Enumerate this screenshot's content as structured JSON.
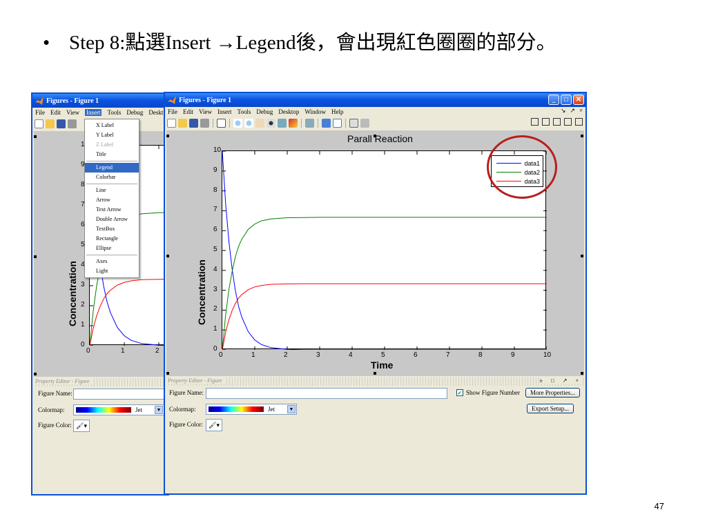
{
  "slide": {
    "bullet": "•",
    "title": "Step 8:點選Insert →Legend後，會出現紅色圈圈的部分。",
    "page_number": "47"
  },
  "window": {
    "title": "Figures - Figure 1",
    "menus": [
      "File",
      "Edit",
      "View",
      "Insert",
      "Tools",
      "Debug",
      "Desktop",
      "Window",
      "Help"
    ],
    "back_menus": [
      "File",
      "Edit",
      "View",
      "Insert",
      "Tools",
      "Debug",
      "Deskt"
    ],
    "menu_right": [
      "↘",
      "↗",
      "×"
    ]
  },
  "insert_menu": {
    "items": [
      {
        "label": "X Label",
        "state": "normal"
      },
      {
        "label": "Y Label",
        "state": "normal"
      },
      {
        "label": "Z Label",
        "state": "disabled"
      },
      {
        "label": "Title",
        "state": "normal"
      },
      {
        "label": "Legend",
        "state": "highlight"
      },
      {
        "label": "Colorbar",
        "state": "normal"
      },
      {
        "label": "Line",
        "state": "normal"
      },
      {
        "label": "Arrow",
        "state": "normal"
      },
      {
        "label": "Text Arrow",
        "state": "normal"
      },
      {
        "label": "Double Arrow",
        "state": "normal"
      },
      {
        "label": "TextBox",
        "state": "normal"
      },
      {
        "label": "Rectangle",
        "state": "normal"
      },
      {
        "label": "Ellipse",
        "state": "normal"
      },
      {
        "label": "Axes",
        "state": "normal"
      },
      {
        "label": "Light",
        "state": "normal"
      }
    ]
  },
  "property_editor": {
    "header": "Property Editor - Figure",
    "controls": [
      "±",
      "□",
      "↗",
      "×"
    ],
    "figure_name_label": "Figure Name:",
    "figure_name_value": "",
    "colormap_label": "Colormap:",
    "colormap_value": "Jet",
    "figure_color_label": "Figure Color:",
    "show_figure_number_label": "Show Figure Number",
    "show_figure_number_checked": "✔",
    "more_properties_label": "More Properties...",
    "export_setup_label": "Export Setup..."
  },
  "colors": {
    "data1": "#0000ff",
    "data2": "#008000",
    "data3": "#ff0000",
    "highlight_circle": "#b81e1e",
    "xp_blue": "#0a4fd8"
  },
  "chart_data": [
    {
      "type": "line",
      "title": "Parall Reaction",
      "xlabel": "Time",
      "ylabel": "Concentration",
      "xlim": [
        0,
        10
      ],
      "ylim": [
        0,
        10
      ],
      "xticks": [
        "0",
        "1",
        "2",
        "3",
        "4",
        "5",
        "6",
        "7",
        "8",
        "9",
        "10"
      ],
      "yticks": [
        "0",
        "1",
        "2",
        "3",
        "4",
        "5",
        "6",
        "7",
        "8",
        "9",
        "10"
      ],
      "legend_position": "top-right",
      "x": [
        0,
        0.1,
        0.2,
        0.3,
        0.4,
        0.5,
        0.6,
        0.8,
        1.0,
        1.2,
        1.5,
        2.0,
        2.5,
        3.0,
        4.0,
        5.0,
        6.0,
        7.0,
        8.0,
        9.0,
        10.0
      ],
      "series": [
        {
          "name": "data1",
          "values": [
            10,
            7.4,
            5.5,
            4.1,
            3.0,
            2.2,
            1.65,
            0.91,
            0.5,
            0.27,
            0.11,
            0.025,
            0.005,
            0.001,
            0,
            0,
            0,
            0,
            0,
            0,
            0
          ]
        },
        {
          "name": "data2",
          "values": [
            0,
            1.73,
            3.0,
            3.93,
            4.67,
            5.2,
            5.57,
            6.07,
            6.33,
            6.49,
            6.59,
            6.65,
            6.66,
            6.67,
            6.67,
            6.67,
            6.67,
            6.67,
            6.67,
            6.67,
            6.67
          ]
        },
        {
          "name": "data3",
          "values": [
            0,
            0.87,
            1.5,
            1.97,
            2.33,
            2.6,
            2.78,
            3.03,
            3.17,
            3.24,
            3.3,
            3.32,
            3.33,
            3.33,
            3.33,
            3.33,
            3.33,
            3.33,
            3.33,
            3.33,
            3.33
          ]
        }
      ]
    },
    {
      "type": "line",
      "title": "",
      "ylabel": "Concentration",
      "xlim": [
        0,
        2.4
      ],
      "ylim": [
        0,
        10
      ],
      "xticks": [
        "0",
        "1",
        "2"
      ],
      "yticks": [
        "0",
        "1",
        "2",
        "3",
        "4",
        "5",
        "6",
        "7",
        "8",
        "9",
        "10"
      ]
    }
  ]
}
